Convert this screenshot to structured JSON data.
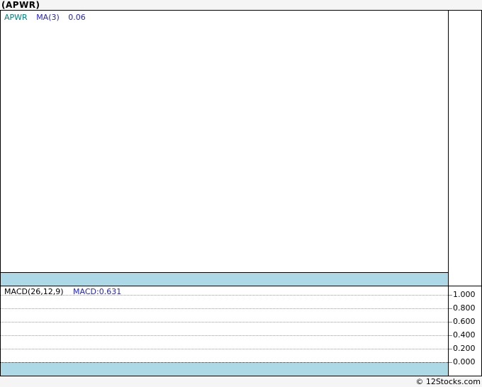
{
  "page": {
    "title": "(APWR)",
    "footer": "© 12Stocks.com"
  },
  "main_panel": {
    "symbol_label": "APWR",
    "ma_label": "MA(3)",
    "ma_value": "0.06"
  },
  "macd_panel": {
    "indicator_label": "MACD(26,12,9)",
    "value_label": "MACD:0.631"
  },
  "y_axis": {
    "labels": [
      "1.000",
      "0.800",
      "0.600",
      "0.400",
      "0.200",
      "0.000"
    ]
  },
  "colors": {
    "band": "#ADD8E6",
    "symbol_text": "#008080",
    "indicator_text": "#2222CC",
    "grid": "#999999",
    "zero_line": "#000000",
    "frame": "#000000",
    "page_bg": "#F5F5F5"
  },
  "chart_data": {
    "type": "line",
    "title": "(APWR)",
    "panels": [
      {
        "name": "price",
        "legend": [
          "APWR",
          "MA(3)"
        ],
        "legend_position": "top-left",
        "readouts": {
          "ma3": 0.06
        },
        "series": [
          {
            "name": "APWR",
            "values": []
          },
          {
            "name": "MA(3)",
            "values": []
          }
        ],
        "grid": false
      },
      {
        "name": "macd",
        "legend": [
          "MACD(26,12,9)"
        ],
        "legend_position": "top-left",
        "readouts": {
          "macd": 0.631
        },
        "series": [],
        "ylim": [
          0.0,
          1.0
        ],
        "y_ticks": [
          1.0,
          0.8,
          0.6,
          0.4,
          0.2,
          0.0
        ],
        "grid": true,
        "grid_style": "dotted"
      }
    ],
    "source": "12Stocks.com"
  }
}
